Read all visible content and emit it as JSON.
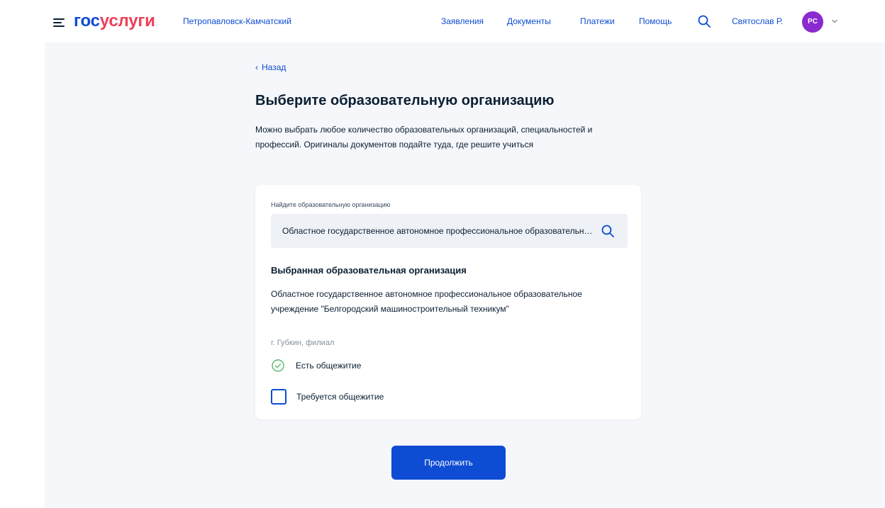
{
  "header": {
    "logo_part1": "гос",
    "logo_part2": "услуги",
    "city": "Петропавловск-Камчатский",
    "nav": [
      "Заявления",
      "Документы",
      "Платежи",
      "Помощь"
    ],
    "user_name": "Святослав Р.",
    "avatar_initials": "PC",
    "icons": {
      "menu": "hamburger-menu-icon",
      "search": "search-icon",
      "chevron": "chevron-down-icon"
    }
  },
  "main": {
    "back_label": "Назад",
    "title": "Выберите образовательную организацию",
    "description": "Можно выбрать любое количество образовательных организаций, специальностей и профессий. Оригиналы документов подайте туда, где решите учиться",
    "search": {
      "label": "Найдите образовательную организацию",
      "value": "Областное государственное автономное профессиональное образовательное учреждение \"Белгородский машиностроительный техникум\""
    },
    "selected": {
      "heading": "Выбранная образовательная организация",
      "org_name": "Областное государственное автономное профессиональное образовательное учреждение \"Белгородский машиностроительный техникум\"",
      "org_sub": "г. Губкин, филиал",
      "has_dorm_label": "Есть общежитие",
      "requires_dorm_label": "Требуется общежитие",
      "requires_dorm_checked": false
    },
    "continue_label": "Продолжить"
  },
  "colors": {
    "accent": "#0d4cd3",
    "brand_red": "#ee3f58",
    "avatar": "#8b2ad0",
    "success": "#5ab86c",
    "background": "#f5f7fa"
  }
}
